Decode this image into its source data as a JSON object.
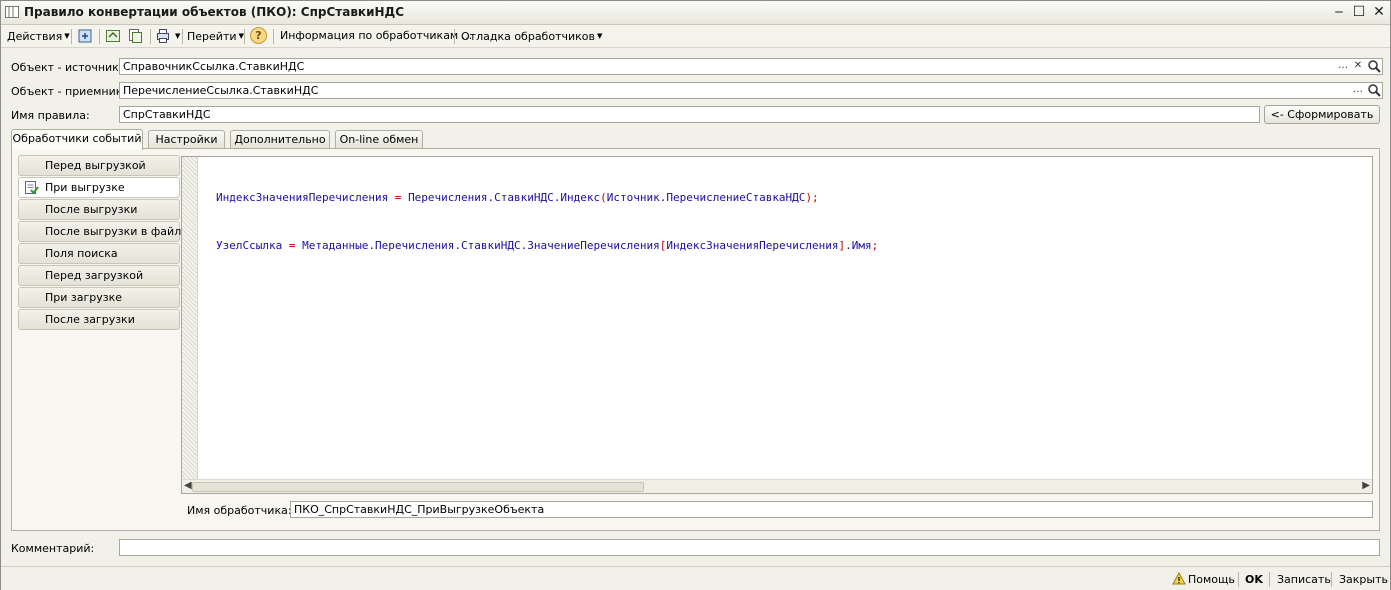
{
  "window": {
    "title": "Правило конвертации объектов (ПКО): СпрСтавкиНДС"
  },
  "toolbar": {
    "actions": "Действия",
    "goto": "Перейти",
    "help_icon": "?",
    "handlers_info": "Информация по обработчикам ...",
    "debug_handlers": "Отладка обработчиков"
  },
  "form": {
    "source_label": "Объект - источник:",
    "source_value": "СправочникСсылка.СтавкиНДС",
    "target_label": "Объект - приемник:",
    "target_value": "ПеречислениеСсылка.СтавкиНДС",
    "rule_name_label": "Имя правила:",
    "rule_name_value": "СпрСтавкиНДС",
    "generate_button": "<- Сформировать",
    "comment_label": "Комментарий:",
    "comment_value": ""
  },
  "tabs": [
    "Обработчики событий",
    "Настройки",
    "Дополнительно",
    "On-line обмен"
  ],
  "events": [
    "Перед выгрузкой",
    "При выгрузке",
    "После выгрузки",
    "После выгрузки в файл",
    "Поля поиска",
    "Перед загрузкой",
    "При загрузке",
    "После загрузки"
  ],
  "editor": {
    "line1": {
      "a": "ИндексЗначенияПеречисления",
      "b": " = ",
      "c": "Перечисления.СтавкиНДС.Индекс",
      "d": "(",
      "e": "Источник.ПеречислениеСтавкаНДС",
      "f": ");"
    },
    "line2": {
      "a": "УзелСсылка",
      "b": " = ",
      "c": "Метаданные.Перечисления.СтавкиНДС.ЗначениеПеречисления",
      "d": "[",
      "e": "ИндексЗначенияПеречисления",
      "f": "]",
      "g": ".Имя",
      "h": ";"
    },
    "handler_label": "Имя обработчика:",
    "handler_value": "ПКО_СпрСтавкиНДС_ПриВыгрузкеОбъекта"
  },
  "statusbar": {
    "help": "Помощь",
    "ok": "OK",
    "save": "Записать",
    "close": "Закрыть"
  }
}
